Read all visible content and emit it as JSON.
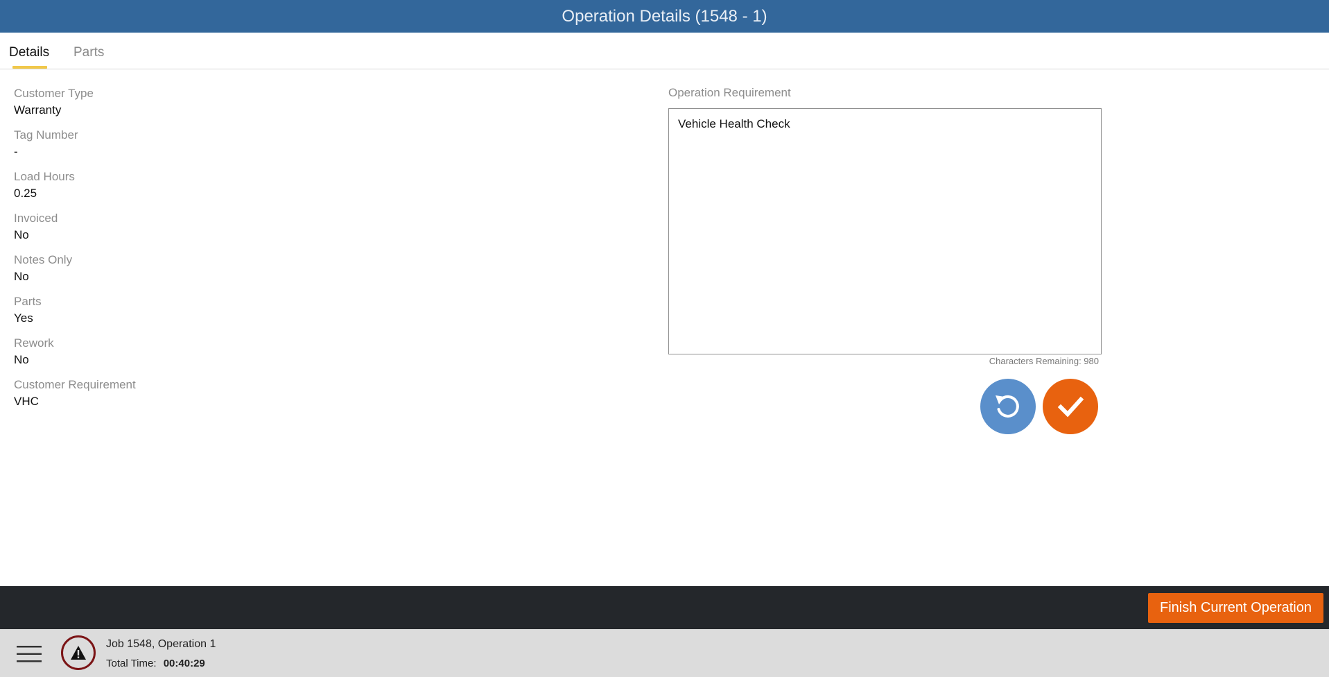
{
  "header": {
    "title": "Operation Details (1548 - 1)"
  },
  "tabs": [
    {
      "label": "Details",
      "active": true
    },
    {
      "label": "Parts",
      "active": false
    }
  ],
  "details": [
    {
      "label": "Customer Type",
      "value": "Warranty"
    },
    {
      "label": "Tag Number",
      "value": "-"
    },
    {
      "label": "Load Hours",
      "value": "0.25"
    },
    {
      "label": "Invoiced",
      "value": "No"
    },
    {
      "label": "Notes Only",
      "value": "No"
    },
    {
      "label": "Parts",
      "value": "Yes"
    },
    {
      "label": "Rework",
      "value": "No"
    },
    {
      "label": "Customer Requirement",
      "value": "VHC"
    }
  ],
  "requirement": {
    "label": "Operation Requirement",
    "value": "Vehicle Health Check",
    "chars_remaining": "Characters Remaining: 980"
  },
  "buttons": {
    "reset_icon": "undo-icon",
    "confirm_icon": "check-icon",
    "finish": "Finish Current Operation"
  },
  "status": {
    "job": "Job 1548, Operation 1",
    "total_time_label": "Total Time:",
    "total_time_value": "00:40:29"
  },
  "colors": {
    "header": "#33679b",
    "accent_orange": "#e8620f",
    "accent_blue": "#5a8fcb",
    "tab_underline": "#f1c84a"
  }
}
